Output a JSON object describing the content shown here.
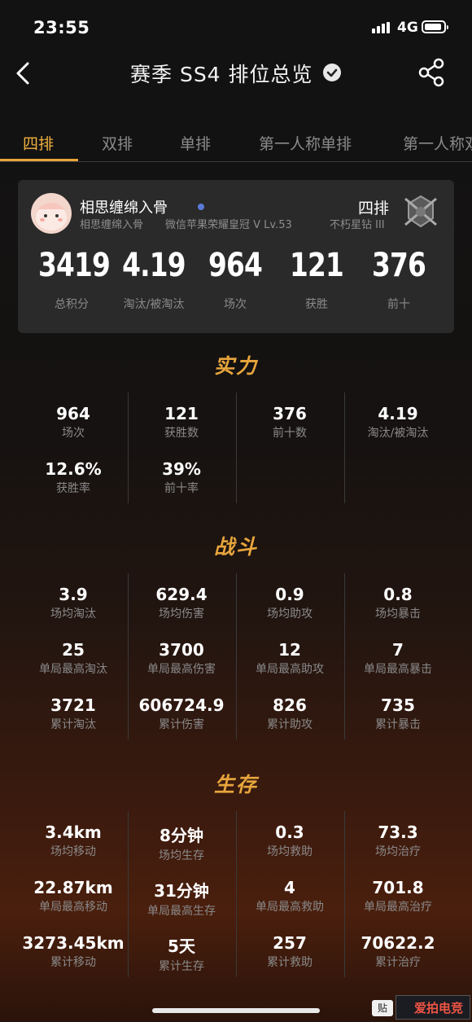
{
  "status": {
    "time": "23:55",
    "network": "4G"
  },
  "nav": {
    "title": "赛季 SS4 排位总览"
  },
  "tabs": [
    "四排",
    "双排",
    "单排",
    "第一人称单排",
    "第一人称双排"
  ],
  "profile": {
    "name": "相思缠绵入骨",
    "sub_name": "相思缠绵入骨",
    "platform": "微信苹果荣耀皇冠 V Lv.53",
    "mode": "四排",
    "tier": "不朽星钻 III",
    "stats": [
      {
        "value": "3419",
        "label": "总积分"
      },
      {
        "value": "4.19",
        "label": "淘汰/被淘汰"
      },
      {
        "value": "964",
        "label": "场次"
      },
      {
        "value": "121",
        "label": "获胜"
      },
      {
        "value": "376",
        "label": "前十"
      }
    ]
  },
  "sections": {
    "strength": {
      "title": "实力",
      "rows": [
        [
          {
            "value": "964",
            "label": "场次"
          },
          {
            "value": "121",
            "label": "获胜数"
          },
          {
            "value": "376",
            "label": "前十数"
          },
          {
            "value": "4.19",
            "label": "淘汰/被淘汰"
          }
        ],
        [
          {
            "value": "12.6%",
            "label": "获胜率"
          },
          {
            "value": "39%",
            "label": "前十率"
          }
        ]
      ]
    },
    "combat": {
      "title": "战斗",
      "rows": [
        [
          {
            "value": "3.9",
            "label": "场均淘汰"
          },
          {
            "value": "629.4",
            "label": "场均伤害"
          },
          {
            "value": "0.9",
            "label": "场均助攻"
          },
          {
            "value": "0.8",
            "label": "场均暴击"
          }
        ],
        [
          {
            "value": "25",
            "label": "单局最高淘汰"
          },
          {
            "value": "3700",
            "label": "单局最高伤害"
          },
          {
            "value": "12",
            "label": "单局最高助攻"
          },
          {
            "value": "7",
            "label": "单局最高暴击"
          }
        ],
        [
          {
            "value": "3721",
            "label": "累计淘汰"
          },
          {
            "value": "606724.9",
            "label": "累计伤害"
          },
          {
            "value": "826",
            "label": "累计助攻"
          },
          {
            "value": "735",
            "label": "累计暴击"
          }
        ]
      ]
    },
    "survival": {
      "title": "生存",
      "rows": [
        [
          {
            "value": "3.4km",
            "label": "场均移动"
          },
          {
            "value": "8分钟",
            "label": "场均生存"
          },
          {
            "value": "0.3",
            "label": "场均救助"
          },
          {
            "value": "73.3",
            "label": "场均治疗"
          }
        ],
        [
          {
            "value": "22.87km",
            "label": "单局最高移动"
          },
          {
            "value": "31分钟",
            "label": "单局最高生存"
          },
          {
            "value": "4",
            "label": "单局最高救助"
          },
          {
            "value": "701.8",
            "label": "单局最高治疗"
          }
        ],
        [
          {
            "value": "3273.45km",
            "label": "累计移动"
          },
          {
            "value": "5天",
            "label": "累计生存"
          },
          {
            "value": "257",
            "label": "累计救助"
          },
          {
            "value": "70622.2",
            "label": "累计治疗"
          }
        ]
      ]
    }
  },
  "watermark": {
    "badge": "贴",
    "site": "爱拍电竞"
  }
}
